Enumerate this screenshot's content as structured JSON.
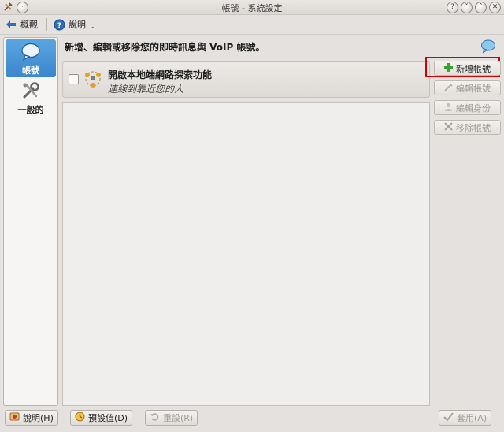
{
  "window": {
    "title": "帳號 - 系統設定"
  },
  "toolbar": {
    "overview_label": "概觀",
    "help_label": "說明"
  },
  "sidebar": {
    "items": [
      {
        "label": "帳號",
        "icon": "speech-bubble-icon"
      },
      {
        "label": "一般的",
        "icon": "wrench-icon"
      }
    ]
  },
  "header": {
    "text": "新增、編輯或移除您的即時訊息與 VoIP 帳號。"
  },
  "account": {
    "name": "開啟本地端網路探索功能",
    "description": "連線到靠近您的人",
    "checked": false
  },
  "buttons": {
    "add": "新增帳號",
    "edit": "編輯帳號",
    "edit_identity": "編輯身份",
    "remove": "移除帳號"
  },
  "bottom": {
    "help": "說明(H)",
    "defaults": "預設值(D)",
    "reset": "重設(R)",
    "apply": "套用(A)"
  },
  "colors": {
    "accent": "#3b86cd",
    "highlight": "#d40000"
  }
}
